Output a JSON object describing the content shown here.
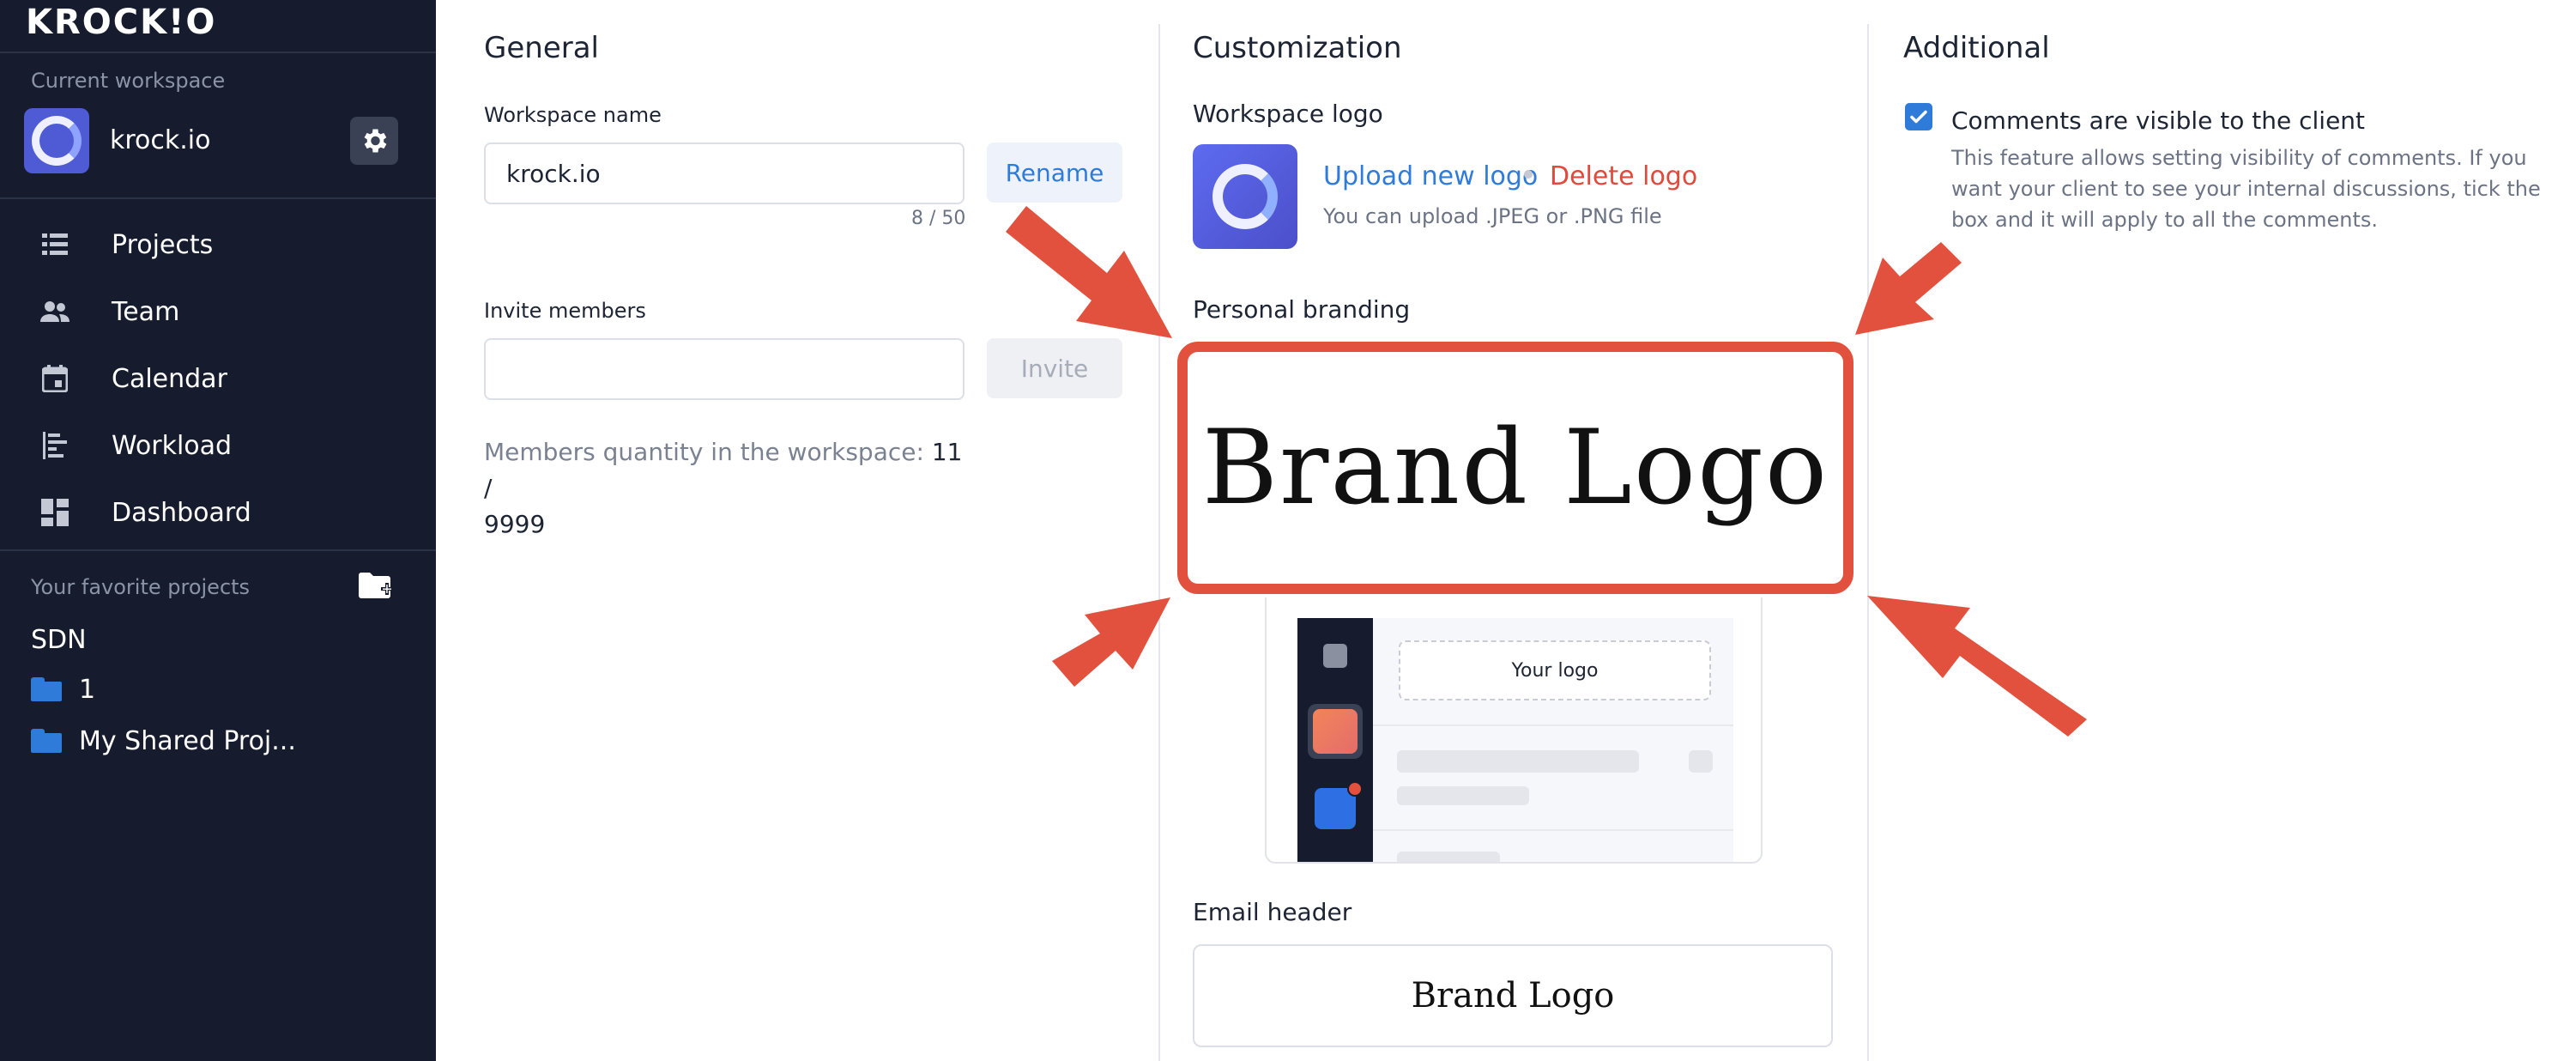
{
  "sidebar": {
    "brand": "KROCK!O",
    "current_workspace_caption": "Current workspace",
    "workspace_name": "krock.io",
    "nav": [
      {
        "label": "Projects",
        "icon": "list-icon"
      },
      {
        "label": "Team",
        "icon": "people-icon"
      },
      {
        "label": "Calendar",
        "icon": "calendar-icon"
      },
      {
        "label": "Workload",
        "icon": "workload-icon"
      },
      {
        "label": "Dashboard",
        "icon": "dashboard-icon"
      }
    ],
    "favorites_caption": "Your favorite projects",
    "project_group": "SDN",
    "projects": [
      {
        "label": "1",
        "icon": "folder-icon"
      },
      {
        "label": "My Shared Proj...",
        "icon": "folder-icon"
      }
    ]
  },
  "general": {
    "title": "General",
    "workspace_name_label": "Workspace name",
    "workspace_name_value": "krock.io",
    "rename_label": "Rename",
    "counter": "8 / 50",
    "invite_label": "Invite members",
    "invite_value": "",
    "invite_button": "Invite",
    "members_text": "Members quantity in the workspace:",
    "members_count": "11 /",
    "members_max": "9999"
  },
  "customization": {
    "title": "Customization",
    "workspace_logo_label": "Workspace logo",
    "upload_link": "Upload new logo",
    "delete_link": "Delete logo",
    "upload_hint": "You can upload .JPEG or .PNG file",
    "personal_branding_label": "Personal branding",
    "brand_logo_text": "Brand Logo",
    "preview_logo_text": "Your logo",
    "email_header_label": "Email header",
    "email_brand_text": "Brand Logo"
  },
  "additional": {
    "title": "Additional",
    "comments_checked": true,
    "comments_label": "Comments are visible to the client",
    "comments_desc": "This feature allows setting visibility of comments. If you want your client to see your internal discussions, tick the box and it will apply to all the comments."
  },
  "colors": {
    "sidebar_bg": "#161c2e",
    "accent_blue": "#2f7bd9",
    "danger_red": "#e04a3c",
    "annotation_arrow": "#e2513d"
  }
}
